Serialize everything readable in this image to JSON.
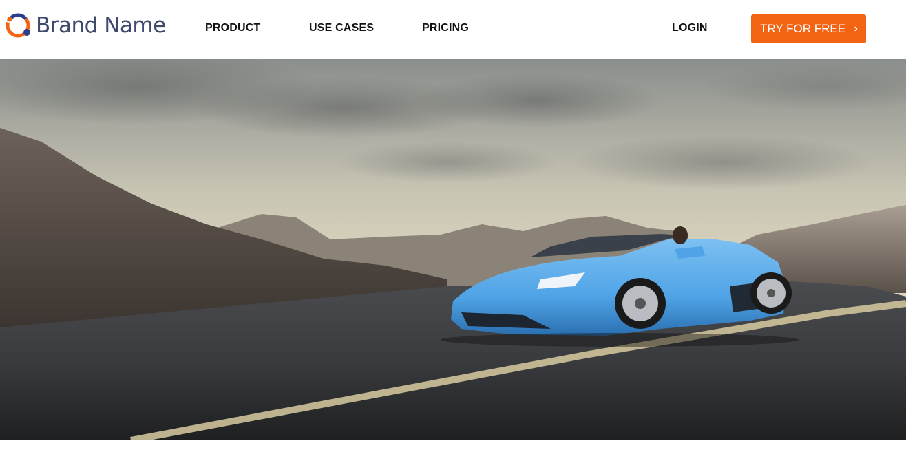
{
  "header": {
    "logo_text": "Brand Name",
    "nav": {
      "product": "PRODUCT",
      "use_cases": "USE CASES",
      "pricing": "PRICING",
      "login": "LOGIN"
    },
    "cta": {
      "label": "TRY FOR FREE",
      "chevron": "›"
    }
  },
  "hero": {
    "image": "blue-convertible-sports-car-on-mountain-road"
  },
  "colors": {
    "accent": "#f26414",
    "logo_text": "#3d4a6e",
    "logo_ring_orange": "#f26414",
    "logo_ring_blue": "#2c3f8f",
    "nav_text": "#111111",
    "car_blue": "#4fa3e6"
  },
  "icons": {
    "logo_mark": "brand-ring-icon",
    "cta_chevron": "chevron-right-icon"
  }
}
